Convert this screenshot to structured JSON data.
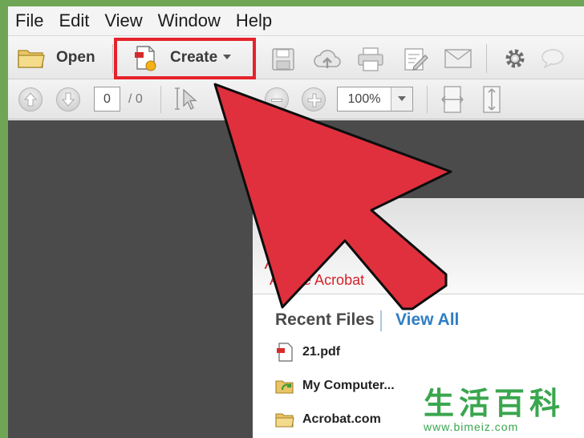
{
  "menubar": {
    "items": [
      "File",
      "Edit",
      "View",
      "Window",
      "Help"
    ]
  },
  "toolbar": {
    "open_label": "Open",
    "create_label": "Create"
  },
  "nav": {
    "page_current": "0",
    "page_total": "/ 0",
    "zoom": "100%"
  },
  "welcome": {
    "brand": "Adobe Acrobat",
    "recent_title": "Recent Files",
    "view_all": "View All",
    "files": [
      "21.pdf",
      "My Computer...",
      "Acrobat.com"
    ]
  },
  "watermark": {
    "chars": "生活百科",
    "url": "www.bimeiz.com"
  },
  "colors": {
    "highlight": "#e5232b",
    "arrow": "#e0303d",
    "link": "#2f7ec4",
    "background": "#6ea655"
  }
}
